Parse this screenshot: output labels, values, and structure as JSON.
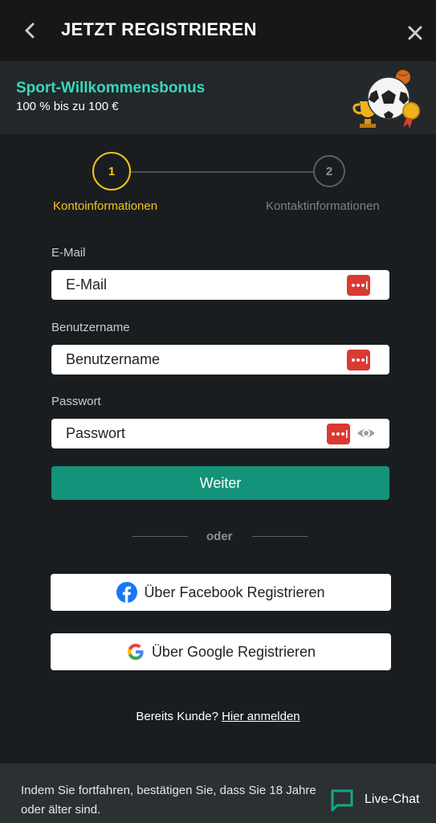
{
  "header": {
    "title": "JETZT REGISTRIEREN",
    "back_icon": "chevron-left-icon",
    "close_icon": "close-icon"
  },
  "bonus": {
    "title": "Sport-Willkommensbonus",
    "subtitle": "100 % bis zu 100 €",
    "accent_color": "#37d9b9"
  },
  "stepper": {
    "steps": [
      {
        "number": "1",
        "label": "Kontoinformationen",
        "active": true
      },
      {
        "number": "2",
        "label": "Kontaktinformationen",
        "active": false
      }
    ],
    "active_color": "#f5c518"
  },
  "form": {
    "email": {
      "label": "E-Mail",
      "placeholder": "E-Mail"
    },
    "username": {
      "label": "Benutzername",
      "placeholder": "Benutzername"
    },
    "password": {
      "label": "Passwort",
      "placeholder": "Passwort"
    },
    "submit_label": "Weiter",
    "submit_color": "#13937a"
  },
  "divider": {
    "text": "oder"
  },
  "social": {
    "facebook_label": "Über Facebook Registrieren",
    "google_label": "Über Google Registrieren"
  },
  "login": {
    "prompt": "Bereits Kunde?",
    "link": "Hier anmelden"
  },
  "footer": {
    "notice": "Indem Sie fortfahren, bestätigen Sie, dass Sie 18 Jahre oder älter sind.",
    "chat_label": "Live-Chat",
    "chat_icon": "chat-bubble-icon"
  }
}
